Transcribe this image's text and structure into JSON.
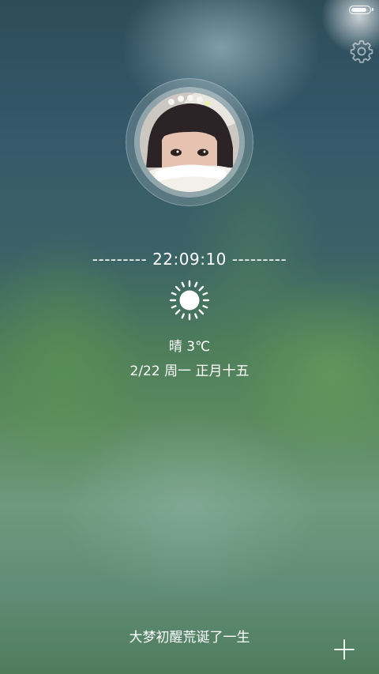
{
  "status_bar": {
    "battery_level": 0.92
  },
  "clock": {
    "left_dashes": "---------",
    "time": "22:09:10",
    "right_dashes": "---------"
  },
  "weather": {
    "icon": "sun-icon",
    "condition": "晴",
    "temperature": "3℃",
    "text": "晴 3℃"
  },
  "date": {
    "text": "2/22 周一 正月十五"
  },
  "motto": {
    "text": "大梦初醒荒诞了一生"
  },
  "icons": {
    "settings": "gear-icon",
    "add": "plus-icon",
    "battery": "battery-icon"
  },
  "colors": {
    "text": "#ffffff"
  }
}
